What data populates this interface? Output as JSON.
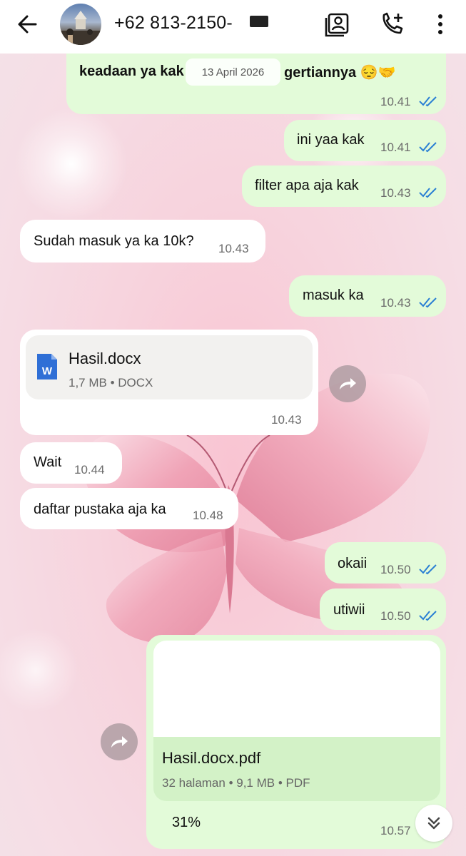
{
  "header": {
    "contact_name": "+62 813-2150-",
    "icons": [
      "back-arrow-icon",
      "contact-card-icon",
      "add-call-icon",
      "more-vert-icon"
    ]
  },
  "date_separator": "13 April 2026",
  "messages": [
    {
      "dir": "out",
      "text": "keadaan ya kak",
      "tail_text": "gertiannya 😔🤝",
      "time": "10.41",
      "status": "read"
    },
    {
      "dir": "out",
      "text": "ini yaa kak",
      "time": "10.41",
      "status": "read"
    },
    {
      "dir": "out",
      "text": "filter apa aja kak",
      "time": "10.43",
      "status": "read"
    },
    {
      "dir": "in",
      "text": "Sudah masuk ya ka 10k?",
      "time": "10.43"
    },
    {
      "dir": "out",
      "text": "masuk ka",
      "time": "10.43",
      "status": "read"
    },
    {
      "dir": "in",
      "type": "document",
      "file_name": "Hasil.docx",
      "file_meta": "1,7 MB • DOCX",
      "file_icon": "W",
      "time": "10.43"
    },
    {
      "dir": "in",
      "text": "Wait",
      "time": "10.44"
    },
    {
      "dir": "in",
      "text": "daftar pustaka aja ka",
      "time": "10.48"
    },
    {
      "dir": "out",
      "text": "okaii",
      "time": "10.50",
      "status": "read"
    },
    {
      "dir": "out",
      "text": "utiwii",
      "time": "10.50",
      "status": "read"
    },
    {
      "dir": "out",
      "type": "document",
      "file_name": "Hasil.docx.pdf",
      "file_meta": "32 halaman • 9,1 MB • PDF",
      "caption": "31%",
      "time": "10.57"
    }
  ],
  "colors": {
    "outgoing": "#e3fbd9",
    "incoming": "#ffffff",
    "read_ticks": "#2a7fd4",
    "word_icon": "#2f6fd6"
  }
}
